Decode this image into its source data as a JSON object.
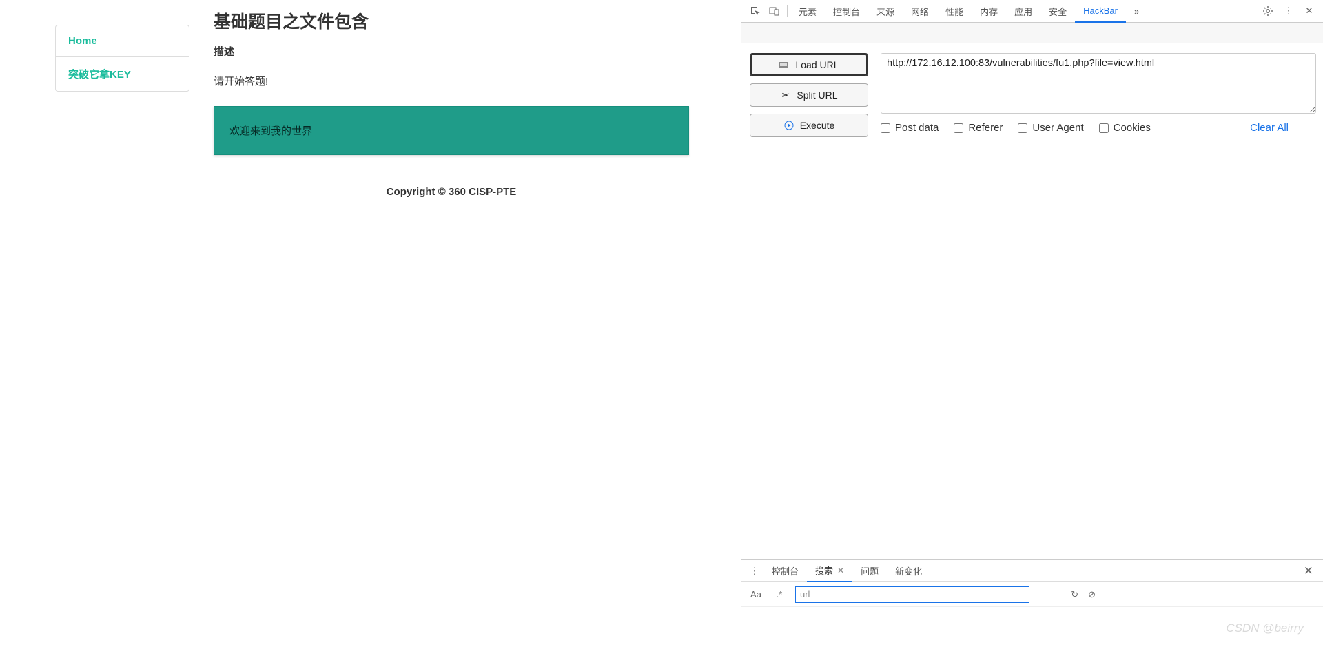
{
  "sidebar": {
    "items": [
      {
        "label": "Home"
      },
      {
        "label": "突破它拿KEY"
      }
    ]
  },
  "content": {
    "title": "基础题目之文件包含",
    "subheading": "描述",
    "prompt": "请开始答题!",
    "highlight": "欢迎来到我的世界"
  },
  "footer": {
    "text": "Copyright © 360 CISP-PTE"
  },
  "devtools": {
    "tabs": [
      "元素",
      "控制台",
      "来源",
      "网络",
      "性能",
      "内存",
      "应用",
      "安全",
      "HackBar"
    ],
    "active_tab": "HackBar",
    "overflow": "»"
  },
  "hackbar": {
    "buttons": {
      "load_url": "Load URL",
      "split_url": "Split URL",
      "execute": "Execute"
    },
    "url_value": "http://172.16.12.100:83/vulnerabilities/fu1.php?file=view.html",
    "checks": {
      "post_data": "Post data",
      "referer": "Referer",
      "user_agent": "User Agent",
      "cookies": "Cookies"
    },
    "clear_all": "Clear All"
  },
  "drawer": {
    "tabs": [
      "控制台",
      "搜索",
      "问题",
      "新变化"
    ],
    "active_tab": "搜索",
    "search_value": "url",
    "aa_label": "Aa",
    "regex_label": ".*"
  },
  "watermark": "CSDN @beirry"
}
